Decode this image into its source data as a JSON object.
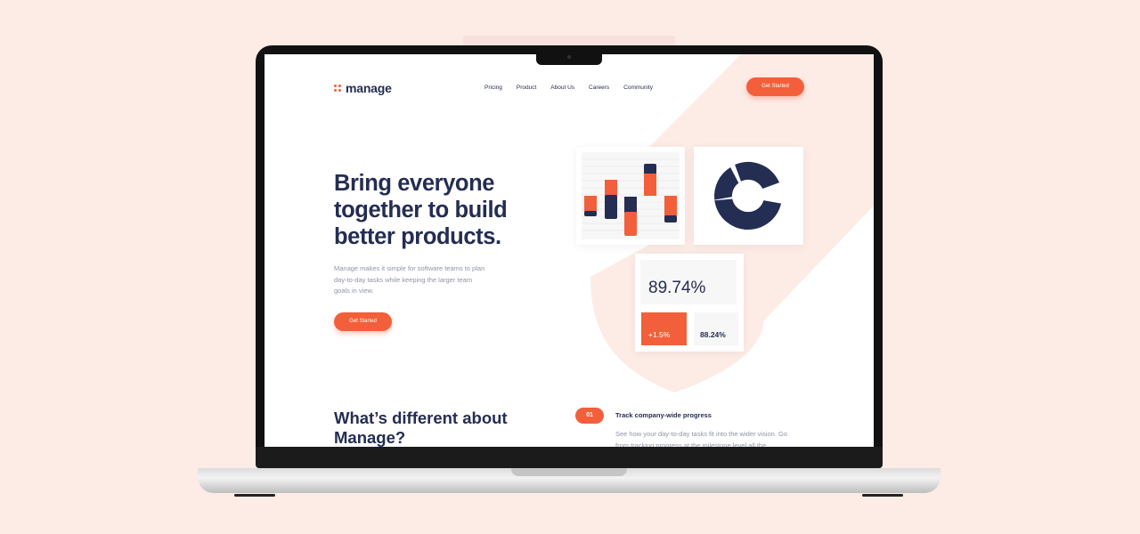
{
  "site": {
    "brand": "manage",
    "nav": [
      "Pricing",
      "Product",
      "About Us",
      "Careers",
      "Community"
    ],
    "header_cta": "Get Started"
  },
  "hero": {
    "title": "Bring everyone together to build better products.",
    "subtitle": "Manage makes it simple for software teams to plan day-to-day tasks while keeping the larger team goals in view.",
    "cta": "Get Started"
  },
  "stats": {
    "main": "89.74%",
    "delta": "+1.5%",
    "secondary": "88.24%"
  },
  "section": {
    "title": "What’s different about Manage?",
    "features": [
      {
        "number": "01",
        "title": "Track company-wide progress",
        "description": "See how your day-to-day tasks fit into the wider vision. Go from tracking progress at the milestone level all the"
      }
    ]
  },
  "colors": {
    "accent": "#f25f3a",
    "navy": "#242d52",
    "background": "#fdebe6"
  }
}
